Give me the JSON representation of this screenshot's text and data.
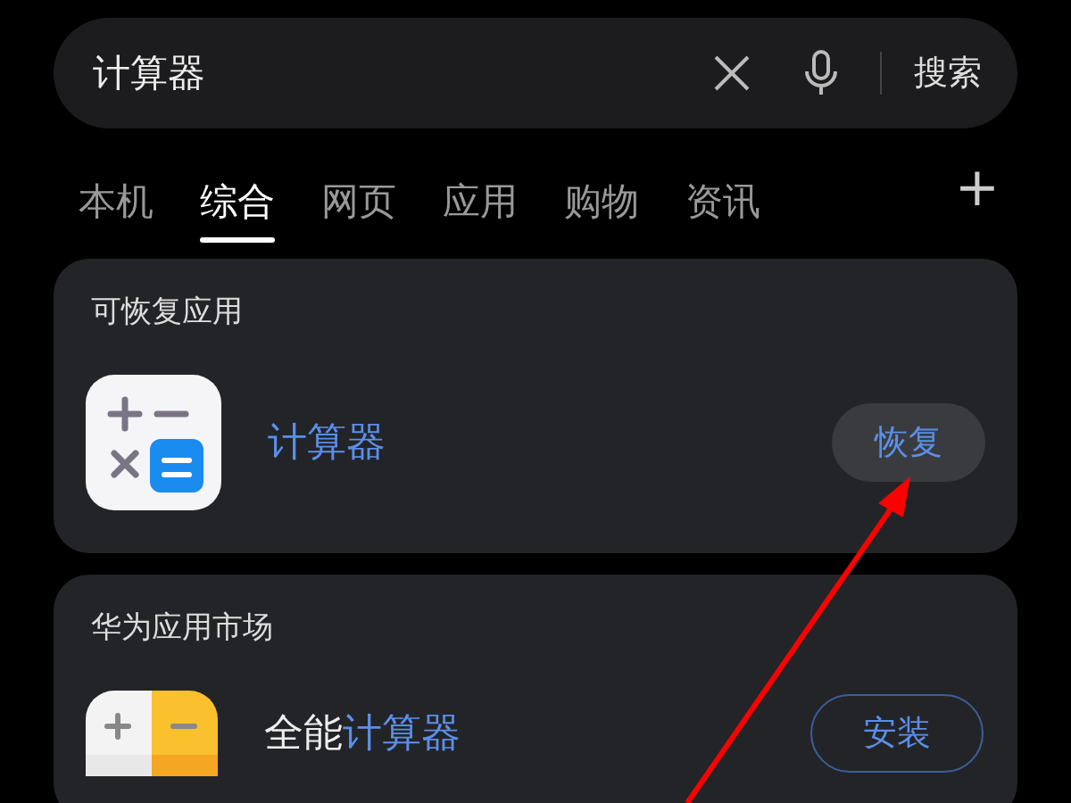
{
  "search": {
    "value": "计算器",
    "button": "搜索"
  },
  "tabs": [
    {
      "label": "本机",
      "selected": false
    },
    {
      "label": "综合",
      "selected": true
    },
    {
      "label": "网页",
      "selected": false
    },
    {
      "label": "应用",
      "selected": false
    },
    {
      "label": "购物",
      "selected": false
    },
    {
      "label": "资讯",
      "selected": false
    }
  ],
  "add_tab": "+",
  "sections": [
    {
      "title": "可恢复应用",
      "app": {
        "kind": "restore",
        "name_parts": [
          {
            "text": "计算器",
            "highlight": true
          }
        ],
        "action": "恢复"
      }
    },
    {
      "title": "华为应用市场",
      "app": {
        "kind": "install",
        "name_parts": [
          {
            "text": "全能",
            "highlight": false
          },
          {
            "text": "计算器",
            "highlight": true
          }
        ],
        "action": "安装"
      }
    }
  ]
}
